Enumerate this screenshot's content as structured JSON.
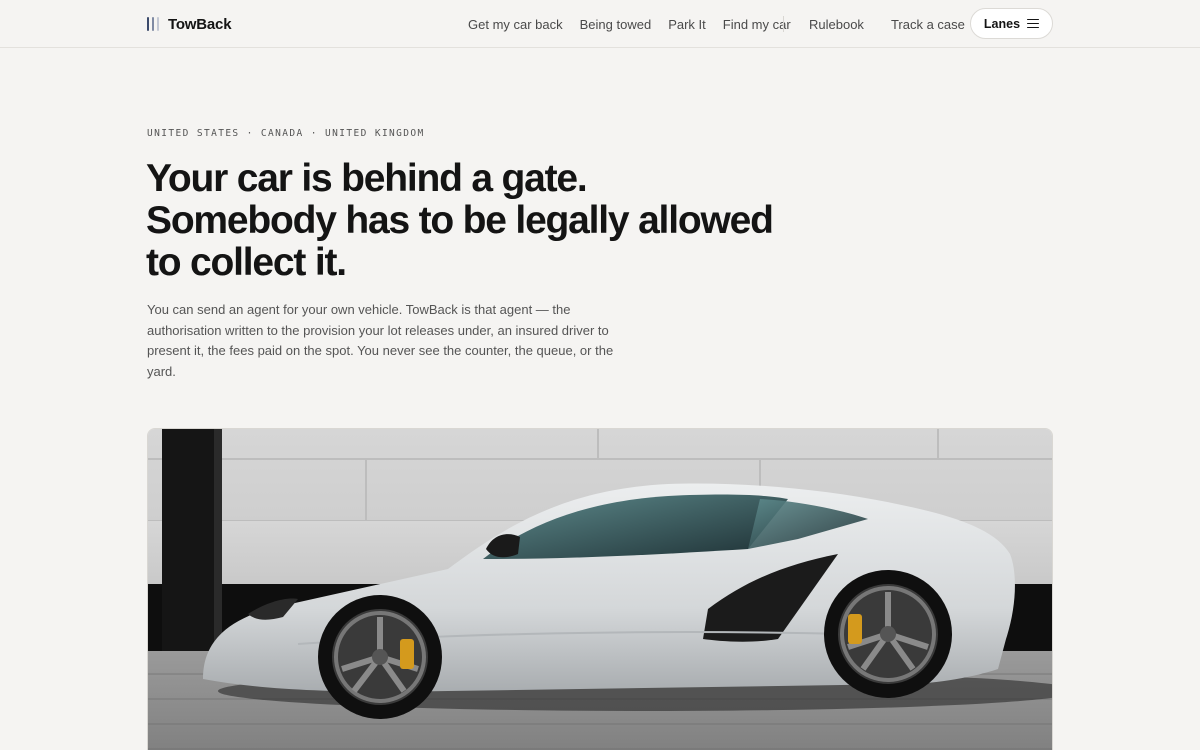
{
  "header": {
    "brand": "TowBack",
    "nav_main": [
      "Get my car back",
      "Being towed",
      "Park It",
      "Find my car"
    ],
    "nav_right": [
      "Rulebook",
      "Track a case"
    ],
    "lanes_label": "Lanes"
  },
  "hero": {
    "eyebrow": "UNITED STATES · CANADA · UNITED KINGDOM",
    "headline": [
      "Your car is behind a gate.",
      "Somebody has to be legally allowed",
      "to collect it."
    ],
    "lede": "You can send an agent for your own vehicle. TowBack is that agent — the authorisation written to the provision your lot releases under, an insured driver to present it, the fees paid on the spot. You never see the counter, the queue, or the yard."
  },
  "colors": {
    "background": "#f5f4f2",
    "text": "#141414",
    "muted": "#555555",
    "brand_mark": [
      "#3b4a6b",
      "#7f8aa3",
      "#c3c8d4"
    ]
  },
  "icons": {
    "brand": "bars-logo-icon",
    "lanes": "menu-icon"
  }
}
